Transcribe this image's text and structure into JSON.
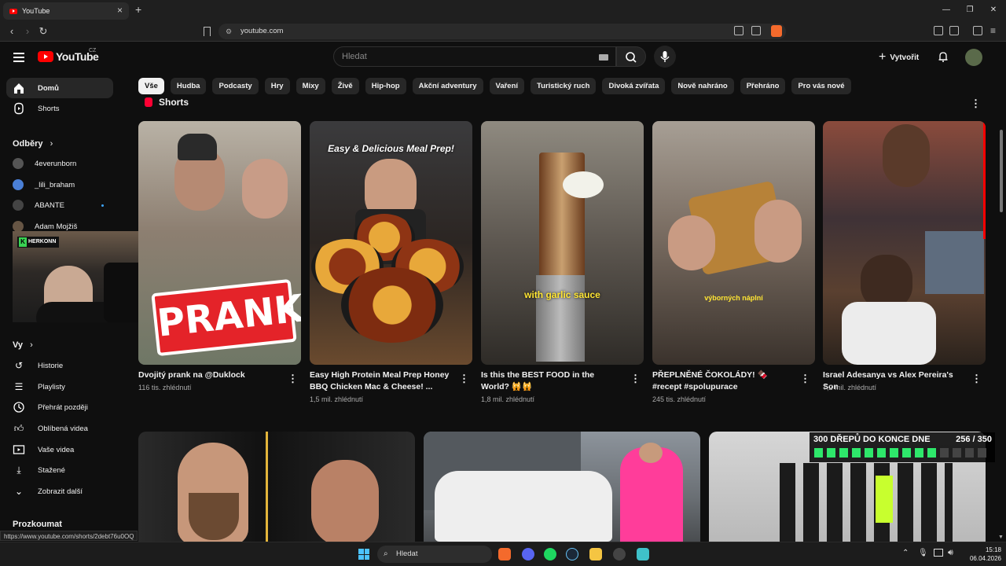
{
  "browser": {
    "tab_title": "YouTube",
    "tab_close": "×",
    "new_tab": "+",
    "url": "youtube.com",
    "window_controls": {
      "minimize": "—",
      "restore": "❐",
      "close": "✕"
    }
  },
  "header": {
    "logo_text": "YouTube",
    "country_code": "CZ",
    "search_placeholder": "Hledat",
    "create_label": "Vytvořit"
  },
  "chips": [
    "Vše",
    "Hudba",
    "Podcasty",
    "Hry",
    "Mixy",
    "Živě",
    "Hip-hop",
    "Akční adventury",
    "Vaření",
    "Turistický ruch",
    "Divoká zvířata",
    "Nově nahráno",
    "Přehráno",
    "Pro vás nové"
  ],
  "sidebar": {
    "home": "Domů",
    "shorts": "Shorts",
    "subscriptions_heading": "Odběry",
    "channels": [
      {
        "name": "4everunborn",
        "color": "#555"
      },
      {
        "name": "_lili_braham",
        "color": "#4a7fd6"
      },
      {
        "name": "ABANTE",
        "color": "#444"
      },
      {
        "name": "Adam Mojžiš",
        "color": "#665544"
      }
    ],
    "you_heading": "Vy",
    "you_items": [
      {
        "label": "Historie",
        "icon": "history-icon"
      },
      {
        "label": "Playlisty",
        "icon": "playlist-icon"
      },
      {
        "label": "Přehrát později",
        "icon": "clock-icon"
      },
      {
        "label": "Oblíbená videa",
        "icon": "like-icon"
      },
      {
        "label": "Vaše videa",
        "icon": "your-videos-icon"
      },
      {
        "label": "Stažené",
        "icon": "download-icon"
      },
      {
        "label": "Zobrazit další",
        "icon": "chevron-down-icon"
      }
    ],
    "explore_heading": "Prozkoumat"
  },
  "webcam": {
    "label": "HERKONN"
  },
  "shorts": {
    "heading": "Shorts",
    "items": [
      {
        "title": "Dvojitý prank na @Duklock",
        "views": "116 tis. zhlédnutí",
        "overlay": "PRANK"
      },
      {
        "title": "Easy High Protein Meal Prep Honey BBQ Chicken Mac & Cheese! ...",
        "views": "1,5 mil. zhlédnutí",
        "overlay": "Easy & Delicious Meal Prep!"
      },
      {
        "title": "Is this the BEST FOOD in the World? 🙀🙀",
        "views": "1,8 mil. zhlédnutí",
        "overlay": "with garlic sauce"
      },
      {
        "title": "PŘEPLNĚNÉ ČOKOLÁDY! 🍫 #recept #spolupurace",
        "views": "245 tis. zhlédnutí",
        "overlay": "výborných náplní"
      },
      {
        "title": "Israel Adesanya vs Alex Pereira's Son",
        "views": "7,2 mil. zhlédnutí",
        "overlay": ""
      }
    ]
  },
  "overlay_progress": {
    "title": "300 DŘEPŮ DO KONCE DNE",
    "count": "256 / 350",
    "filled_segments": 10,
    "total_segments": 14
  },
  "status_url": "https://www.youtube.com/shorts/2debt76u0OQ",
  "taskbar": {
    "search_label": "Hledat",
    "time": "15:18",
    "date": "06.04.2026"
  },
  "colors": {
    "accent": "#ff0000",
    "background": "#0f0f0f",
    "chip_bg": "#272727",
    "progress_green": "#2ee86b"
  }
}
